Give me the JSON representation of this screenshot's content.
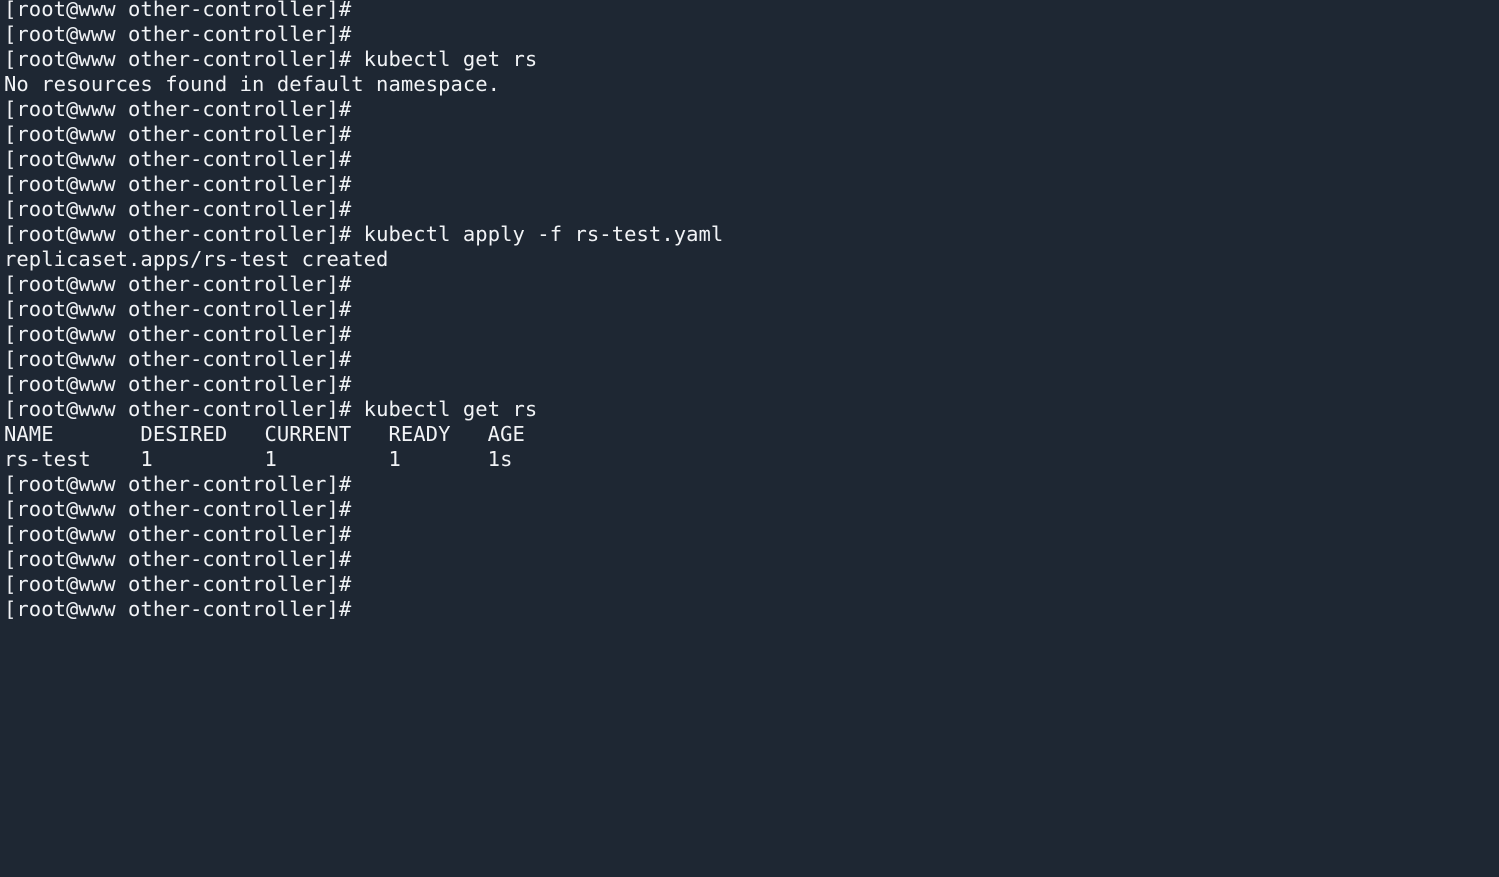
{
  "terminal": {
    "background_color": "#1e2733",
    "foreground_color": "#f1f3f6",
    "prompt": "[root@www other-controller]#",
    "columns": {
      "name": 0,
      "desired": 10,
      "current": 20,
      "ready": 30,
      "age": 38
    },
    "table": {
      "headers": [
        "NAME",
        "DESIRED",
        "CURRENT",
        "READY",
        "AGE"
      ],
      "rows": [
        [
          "rs-test",
          "1",
          "1",
          "1",
          "1s"
        ]
      ]
    },
    "commands": {
      "get_rs": "kubectl get rs",
      "apply_rs_test": "kubectl apply -f rs-test.yaml"
    },
    "outputs": {
      "no_resources": "No resources found in default namespace.",
      "replicaset_created": "replicaset.apps/rs-test created"
    },
    "lines": [
      {
        "kind": "prompt",
        "command": ""
      },
      {
        "kind": "prompt",
        "command": ""
      },
      {
        "kind": "prompt",
        "command": "kubectl get rs"
      },
      {
        "kind": "output",
        "text": "No resources found in default namespace."
      },
      {
        "kind": "prompt",
        "command": ""
      },
      {
        "kind": "prompt",
        "command": ""
      },
      {
        "kind": "prompt",
        "command": ""
      },
      {
        "kind": "prompt",
        "command": ""
      },
      {
        "kind": "prompt",
        "command": ""
      },
      {
        "kind": "prompt",
        "command": "kubectl apply -f rs-test.yaml"
      },
      {
        "kind": "output",
        "text": "replicaset.apps/rs-test created"
      },
      {
        "kind": "prompt",
        "command": ""
      },
      {
        "kind": "prompt",
        "command": ""
      },
      {
        "kind": "prompt",
        "command": ""
      },
      {
        "kind": "prompt",
        "command": ""
      },
      {
        "kind": "prompt",
        "command": ""
      },
      {
        "kind": "prompt",
        "command": "kubectl get rs"
      },
      {
        "kind": "output",
        "text": "NAME       DESIRED   CURRENT   READY   AGE"
      },
      {
        "kind": "output",
        "text": "rs-test    1         1         1       1s"
      },
      {
        "kind": "prompt",
        "command": ""
      },
      {
        "kind": "prompt",
        "command": ""
      },
      {
        "kind": "prompt",
        "command": ""
      },
      {
        "kind": "prompt",
        "command": ""
      },
      {
        "kind": "prompt",
        "command": ""
      },
      {
        "kind": "prompt",
        "command": ""
      }
    ]
  }
}
